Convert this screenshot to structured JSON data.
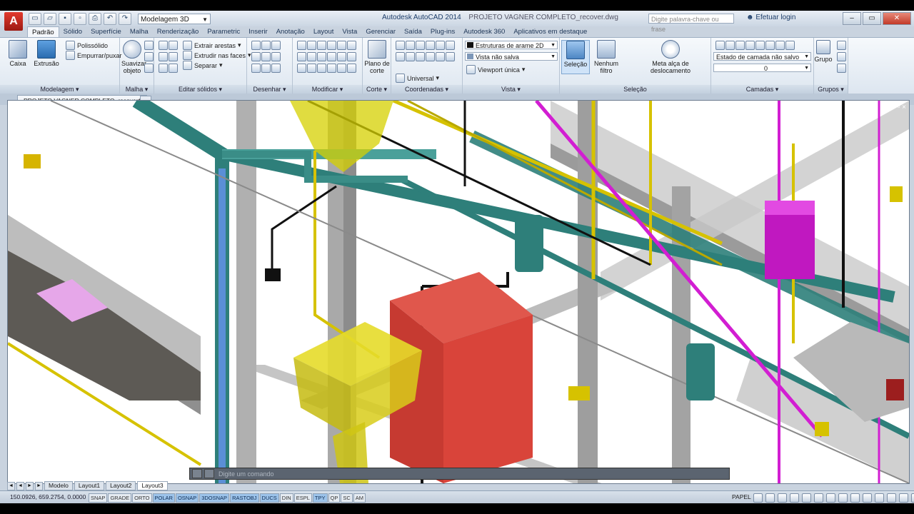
{
  "titlebar": {
    "workspace": "Modelagem 3D",
    "app_title": "Autodesk AutoCAD 2014",
    "file_title": "PROJETO VAGNER COMPLETO_recover.dwg",
    "search_placeholder": "Digite palavra-chave ou frase",
    "login": "Efetuar login"
  },
  "ribbon_tabs": [
    "Padrão",
    "Sólido",
    "Superfície",
    "Malha",
    "Renderização",
    "Parametric",
    "Inserir",
    "Anotação",
    "Layout",
    "Vista",
    "Gerenciar",
    "Saída",
    "Plug-ins",
    "Autodesk 360",
    "Aplicativos em destaque"
  ],
  "panels": {
    "modelagem": {
      "title": "Modelagem",
      "caixa": "Caixa",
      "extrusao": "Extrusão",
      "polisolido": "Polissólido",
      "empurrar": "Empurrar/puxar"
    },
    "malha": {
      "title": "Malha",
      "suavizar": "Suavizar objeto"
    },
    "editar_solidos": {
      "title": "Editar sólidos",
      "extrair": "Extrair arestas",
      "extrudir": "Extrudir nas faces",
      "separar": "Separar"
    },
    "desenhar": {
      "title": "Desenhar"
    },
    "modificar": {
      "title": "Modificar"
    },
    "corte": {
      "title": "Corte",
      "plano": "Plano de corte"
    },
    "coordenadas": {
      "title": "Coordenadas",
      "universal": "Universal"
    },
    "vista": {
      "title": "Vista",
      "estilo": "Estruturas de arame 2D",
      "vista_salva": "Vista não salva",
      "viewport": "Viewport única"
    },
    "selecao": {
      "title": "Seleção",
      "selecao": "Seleção",
      "nenhum_filtro": "Nenhum filtro",
      "meta_alca": "Meta alça de deslocamento"
    },
    "camadas": {
      "title": "Camadas",
      "estado": "Estado de camada não salvo",
      "layer": "0"
    },
    "grupos": {
      "title": "Grupos",
      "grupo": "Grupo"
    }
  },
  "file_tab": "PROJETO VAGNER COMPLETO_recover*",
  "command_placeholder": "Digite um comando",
  "layout_tabs": [
    "Modelo",
    "Layout1",
    "Layout2",
    "Layout3"
  ],
  "status": {
    "coords": "150.0926, 659.2754, 0.0000",
    "toggles": [
      "SNAP",
      "GRADE",
      "ORTO",
      "POLAR",
      "OSNAP",
      "3DOSNAP",
      "RASTOBJ",
      "DUCS",
      "DIN",
      "ESPL",
      "TPY",
      "QP",
      "SC",
      "AM"
    ],
    "toggles_on": [
      "POLAR",
      "OSNAP",
      "3DOSNAP",
      "RASTOBJ",
      "DUCS",
      "TPY"
    ],
    "paper": "PAPEL"
  },
  "colors": {
    "ribbon_bg": "#e6edf5",
    "pipe_teal": "#2e7f7a",
    "pipe_blue": "#5a8fd6",
    "pipe_yellow": "#d6c200",
    "pipe_magenta": "#d21ed2",
    "tank_red": "#d9443a",
    "structure_gray": "#9a9a9a"
  }
}
